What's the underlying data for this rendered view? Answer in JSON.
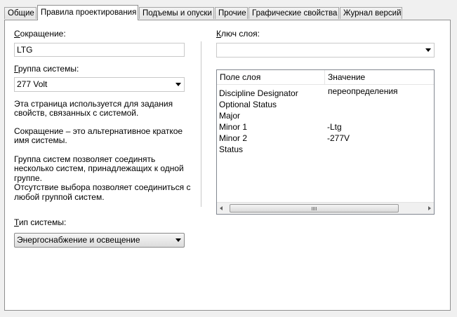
{
  "tabs": [
    {
      "label": "Общие"
    },
    {
      "label": "Правила проектирования"
    },
    {
      "label": "Подъемы и опуски"
    },
    {
      "label": "Прочие"
    },
    {
      "label": "Графические свойства"
    },
    {
      "label": "Журнал версий"
    }
  ],
  "active_tab": "Правила проектирования",
  "left": {
    "abbr_label": "Сокращение:",
    "abbr_value": "LTG",
    "group_label": "Группа системы:",
    "group_value": "277 Volt",
    "desc1_l1": "Эта страница используется для задания",
    "desc1_l2": "свойств, связанных с системой.",
    "desc2_l1": "Сокращение – это альтернативное краткое",
    "desc2_l2": "имя системы.",
    "desc3_l1": "Группа систем позволяет соединять",
    "desc3_l2": "несколько систем, принадлежащих к одной",
    "desc3_l3": "группе.",
    "desc3_l4": "Отсутствие выбора позволяет соединиться с",
    "desc3_l5": "любой группой систем.",
    "type_label": "Тип системы:",
    "type_value": "Энергоснабжение и освещение"
  },
  "right": {
    "layer_key_label": "Ключ слоя:",
    "layer_key_value": "",
    "table": {
      "col1": "Поле слоя",
      "col2": "Значение переопределения",
      "rows": [
        {
          "field": "Discipline Designator",
          "value": ""
        },
        {
          "field": "Optional Status",
          "value": ""
        },
        {
          "field": "Major",
          "value": ""
        },
        {
          "field": "Minor 1",
          "value": "-Ltg"
        },
        {
          "field": "Minor 2",
          "value": "-277V"
        },
        {
          "field": "Status",
          "value": ""
        }
      ]
    }
  }
}
